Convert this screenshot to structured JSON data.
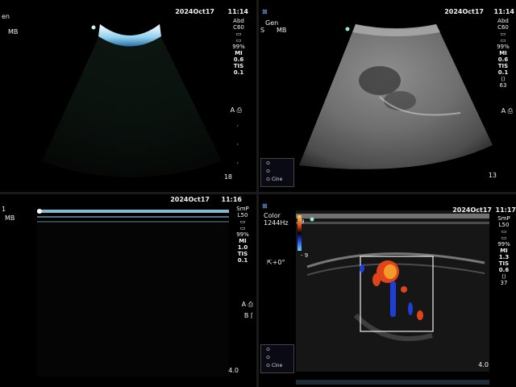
{
  "q1": {
    "left_label_1": "en",
    "left_label_2": "MB",
    "date": "2024Oct17",
    "time": "11:14",
    "params": [
      "Abd",
      "C60",
      "99%",
      "MI",
      "0.6",
      "TIS",
      "0.1"
    ],
    "depth": "18"
  },
  "q2": {
    "left_label_1": "Gen",
    "left_label_2": "S",
    "left_label_3": "MB",
    "date": "2024Oct17",
    "time": "11:14",
    "params": [
      "Abd",
      "C60",
      "99%",
      "MI",
      "0.6",
      "TIS",
      "0.1",
      "63"
    ],
    "depth": "13",
    "cine": "Cine"
  },
  "q3": {
    "left_label_1": "1",
    "left_label_2": "MB",
    "date": "2024Oct17",
    "time": "11:16",
    "params": [
      "SmP",
      "L50",
      "99%",
      "MI",
      "1.0",
      "TIS",
      "0.1"
    ],
    "marker_a": "A",
    "marker_b": "B",
    "depth": "4.0"
  },
  "q4": {
    "color_label": "Color",
    "prf": "1244Hz",
    "scale_top": "9",
    "scale_bottom": "- 9",
    "angle": "+0°",
    "date": "2024Oct17",
    "time": "11:17",
    "params": [
      "SmP",
      "L50",
      "99%",
      "MI",
      "1.3",
      "TIS",
      "0.6",
      "37"
    ],
    "depth": "4.0",
    "cine": "Cine"
  },
  "colors": {
    "color_red": "#e0451a",
    "color_orange": "#f29b2a",
    "color_blue": "#1d3fd6",
    "roi_box": "#f0f0f0"
  }
}
